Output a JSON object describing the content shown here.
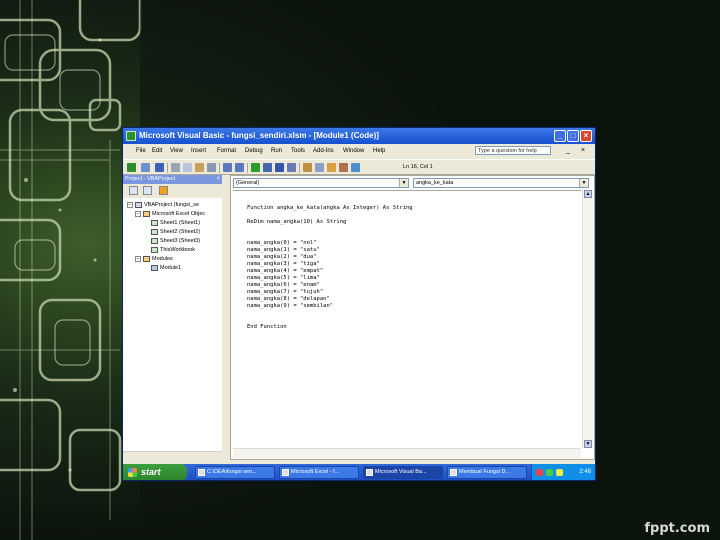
{
  "slide": {
    "footer": "fppt.com"
  },
  "window": {
    "title": "Microsoft Visual Basic - fungsi_sendiri.xlsm - [Module1 (Code)]",
    "controls": [
      "_",
      "□",
      "×"
    ]
  },
  "menu": {
    "items": [
      "File",
      "Edit",
      "View",
      "Insert",
      "Format",
      "Debug",
      "Run",
      "Tools",
      "Add-Ins",
      "Window",
      "Help"
    ],
    "question_box": "Type a question for help",
    "mdi_controls": [
      "_",
      "×"
    ]
  },
  "toolbar": {
    "position": "Ln 16, Col 1"
  },
  "project": {
    "header": "Project - VBAProject",
    "close": "×",
    "tree": [
      {
        "label": "VBAProject (fungsi_se",
        "level": 0,
        "expander": "−"
      },
      {
        "label": "Microsoft Excel Objec",
        "level": 1,
        "expander": "−"
      },
      {
        "label": "Sheet1 (Sheet1)",
        "level": 2,
        "expander": ""
      },
      {
        "label": "Sheet2 (Sheet2)",
        "level": 2,
        "expander": ""
      },
      {
        "label": "Sheet3 (Sheet3)",
        "level": 2,
        "expander": ""
      },
      {
        "label": "ThisWorkbook",
        "level": 2,
        "expander": ""
      },
      {
        "label": "Modules",
        "level": 1,
        "expander": "−"
      },
      {
        "label": "Module1",
        "level": 2,
        "expander": ""
      }
    ]
  },
  "code": {
    "object_combo": "(General)",
    "proc_combo": "angka_ke_kata",
    "lines": [
      "Function angka_ke_kata(angka As Integer) As String",
      "",
      "ReDim nama_angka(10) As String",
      "",
      "nama_angka(0) = \"nol\"",
      "nama_angka(1) = \"satu\"",
      "nama_angka(2) = \"dua\"",
      "nama_angka(3) = \"tiga\"",
      "nama_angka(4) = \"empat\"",
      "nama_angka(5) = \"lima\"",
      "nama_angka(6) = \"enam\"",
      "nama_angka(7) = \"tujuh\"",
      "nama_angka(8) = \"delapan\"",
      "nama_angka(9) = \"sembilan\"",
      "",
      "End Function"
    ]
  },
  "taskbar": {
    "start": "start",
    "tasks": [
      "C:\\DEA\\fungsi sen...",
      "Microsoft Excel - f...",
      "Microsoft Visual Ba...",
      "Membuat Fungsi D..."
    ],
    "clock": "2:46"
  }
}
